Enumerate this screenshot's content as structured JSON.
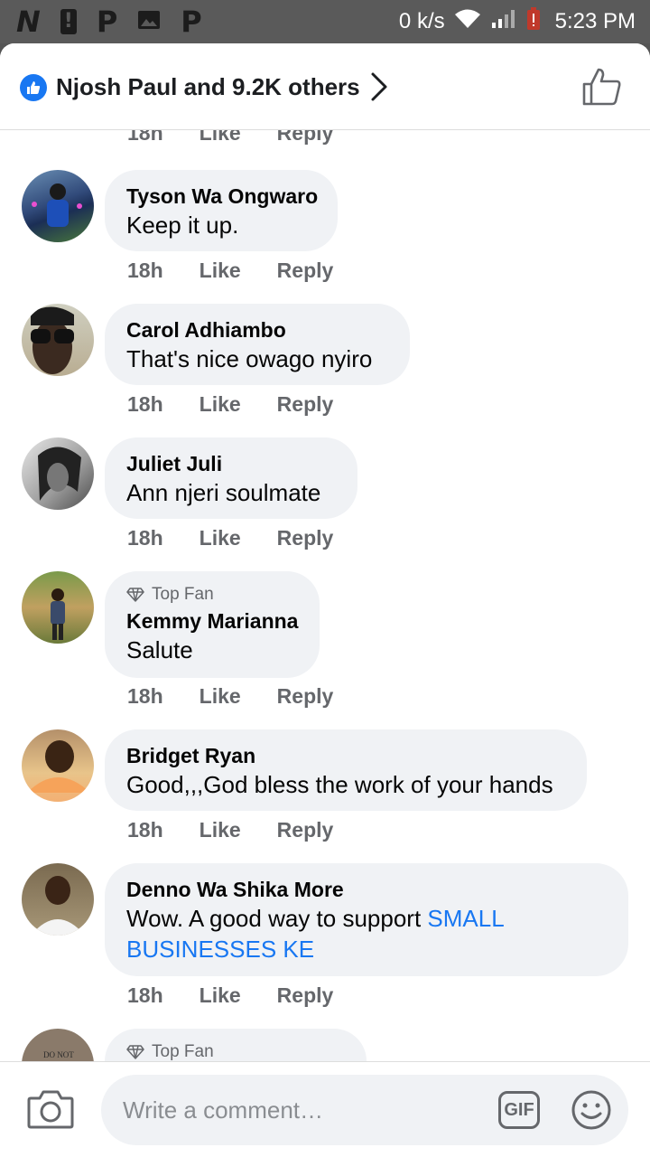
{
  "status_bar": {
    "left_icons": [
      "N",
      "!",
      "P",
      "image",
      "P"
    ],
    "speed": "0 k/s",
    "time": "5:23 PM"
  },
  "header": {
    "reactions_text": "Njosh Paul and 9.2K others"
  },
  "cut_row": {
    "time": "18h",
    "like": "Like",
    "reply": "Reply"
  },
  "comments": [
    {
      "name": "Tyson Wa Ongwaro",
      "text": "Keep it up.",
      "time": "18h",
      "like": "Like",
      "reply": "Reply"
    },
    {
      "name": "Carol Adhiambo",
      "text": "That's nice owago nyiro",
      "time": "18h",
      "like": "Like",
      "reply": "Reply"
    },
    {
      "name": "Juliet Juli",
      "text": "Ann njeri soulmate",
      "time": "18h",
      "like": "Like",
      "reply": "Reply"
    },
    {
      "badge": "Top Fan",
      "name": "Kemmy Marianna",
      "text": "Salute",
      "time": "18h",
      "like": "Like",
      "reply": "Reply"
    },
    {
      "name": "Bridget Ryan",
      "text": "Good,,,God bless the work of your hands",
      "time": "18h",
      "like": "Like",
      "reply": "Reply"
    },
    {
      "name": "Denno Wa Shika More",
      "text_prefix": "Wow. A good way to support ",
      "mention": "SMALL BUSINESSES KE",
      "time": "18h",
      "like": "Like",
      "reply": "Reply"
    },
    {
      "badge": "Top Fan",
      "avatar_text": "DO NOT"
    }
  ],
  "composer": {
    "placeholder": "Write a comment…",
    "gif_label": "GIF"
  },
  "colors": {
    "accent": "#1877f2",
    "bubble": "#f0f2f5",
    "secondary_text": "#65676b"
  }
}
